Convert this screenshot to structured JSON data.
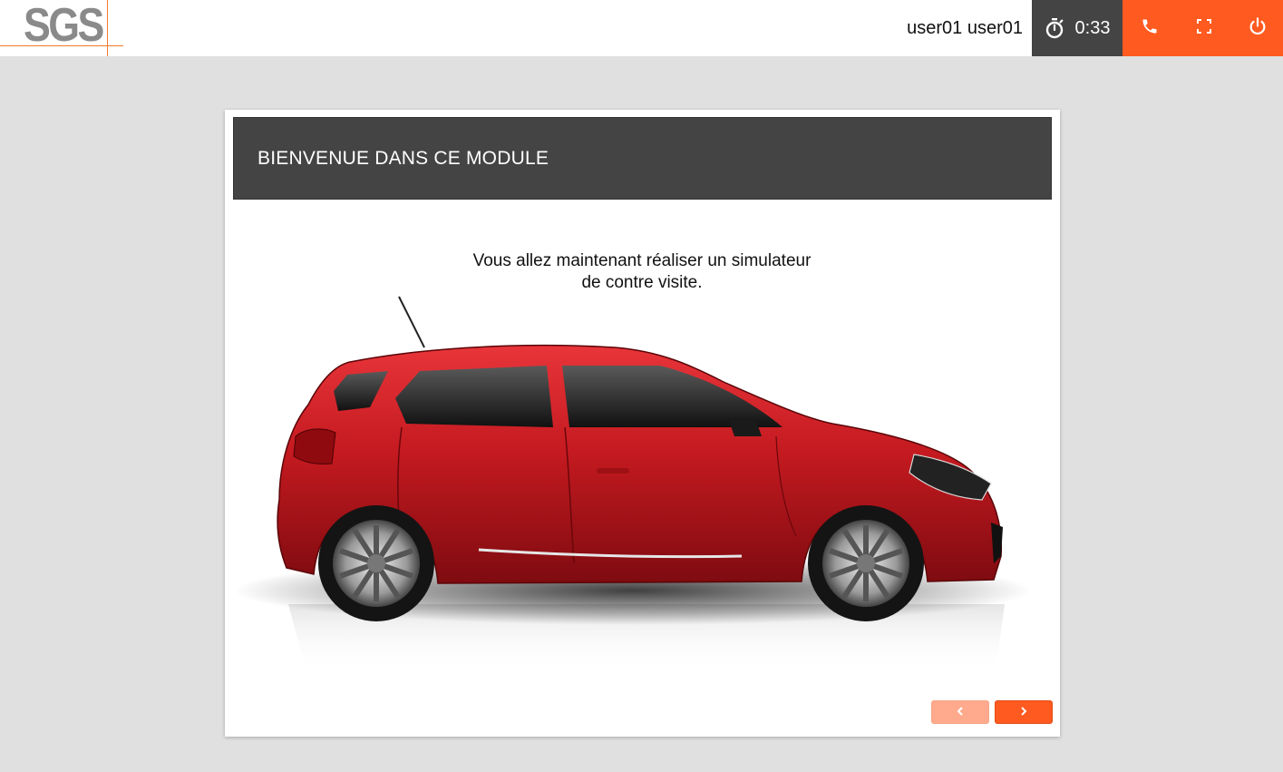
{
  "header": {
    "logo_text": "SGS",
    "username": "user01 user01",
    "timer": {
      "icon": "stopwatch-icon",
      "value": "0:33"
    },
    "actions": [
      {
        "icon": "phone-icon"
      },
      {
        "icon": "fullscreen-icon"
      },
      {
        "icon": "power-icon"
      }
    ]
  },
  "module": {
    "title": "BIENVENUE DANS CE MODULE",
    "message_line1": "Vous allez maintenant réaliser un simulateur",
    "message_line2": "de contre visite."
  },
  "navigation": {
    "prev_icon": "chevron-left-icon",
    "next_icon": "chevron-right-icon"
  },
  "colors": {
    "accent": "#ff5a20",
    "accent_disabled": "#ffaa8c",
    "dark": "#444444",
    "background": "#e0e0e0",
    "logo_line": "#f07a2a"
  }
}
